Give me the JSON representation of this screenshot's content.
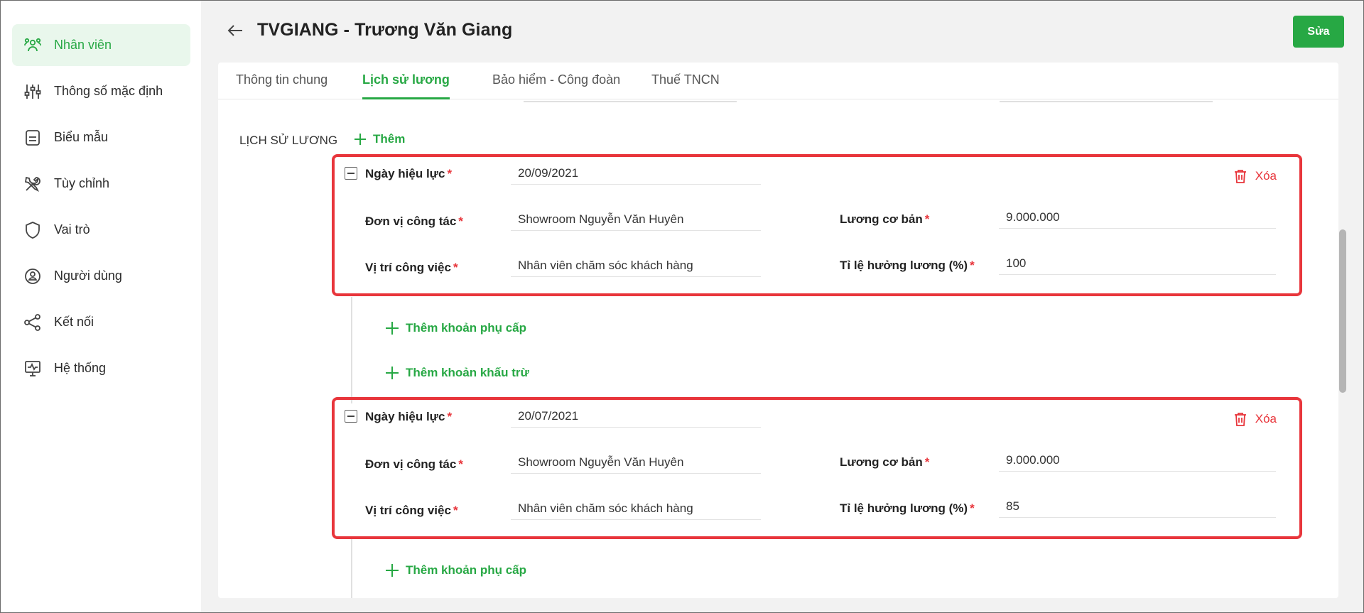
{
  "colors": {
    "accent": "#27a844",
    "danger": "#e8353b",
    "active_bg": "#e9f7ec"
  },
  "sidebar": {
    "items": [
      {
        "label": "Nhân viên",
        "icon": "people-icon",
        "active": true
      },
      {
        "label": "Thông số mặc định",
        "icon": "sliders-icon"
      },
      {
        "label": "Biểu mẫu",
        "icon": "document-icon"
      },
      {
        "label": "Tùy chỉnh",
        "icon": "tools-icon"
      },
      {
        "label": "Vai trò",
        "icon": "shield-icon"
      },
      {
        "label": "Người dùng",
        "icon": "user-circle-icon"
      },
      {
        "label": "Kết nối",
        "icon": "share-icon"
      },
      {
        "label": "Hệ thống",
        "icon": "monitor-icon"
      }
    ]
  },
  "header": {
    "title": "TVGIANG - Trương Văn Giang",
    "edit_label": "Sửa"
  },
  "tabs": [
    {
      "label": "Thông tin chung"
    },
    {
      "label": "Lịch sử lương",
      "active": true
    },
    {
      "label": "Bảo hiểm - Công đoàn"
    },
    {
      "label": "Thuế TNCN"
    }
  ],
  "salary_history": {
    "section_title": "LỊCH SỬ LƯƠNG",
    "add_label": "Thêm",
    "delete_label": "Xóa",
    "add_allowance_label": "Thêm khoản phụ cấp",
    "add_deduction_label": "Thêm khoản khấu trừ",
    "labels": {
      "effective_date": "Ngày hiệu lực",
      "unit": "Đơn vị công tác",
      "position": "Vị trí công việc",
      "base_salary": "Lương cơ bản",
      "salary_ratio": "Tỉ lệ hưởng lương (%)"
    },
    "records": [
      {
        "effective_date": "20/09/2021",
        "unit": "Showroom Nguyễn Văn Huyên",
        "position": "Nhân viên chăm sóc khách hàng",
        "base_salary": "9.000.000",
        "salary_ratio": "100"
      },
      {
        "effective_date": "20/07/2021",
        "unit": "Showroom Nguyễn Văn Huyên",
        "position": "Nhân viên chăm sóc khách hàng",
        "base_salary": "9.000.000",
        "salary_ratio": "85"
      }
    ]
  }
}
